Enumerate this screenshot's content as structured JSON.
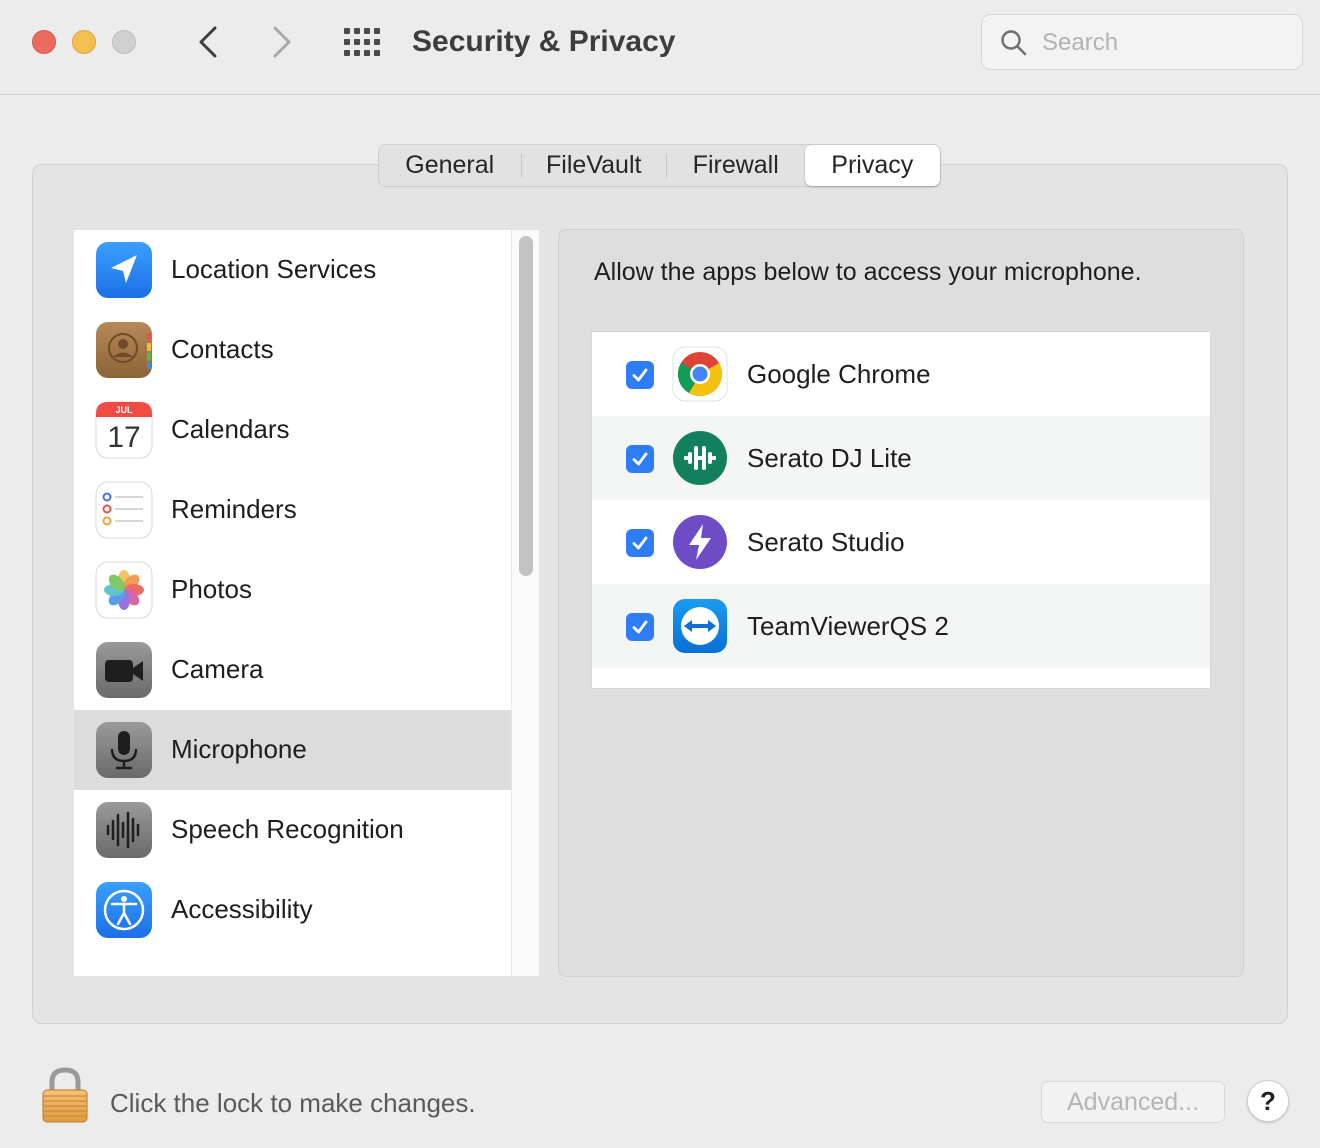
{
  "window": {
    "title": "Security & Privacy",
    "search_placeholder": "Search",
    "search_value": ""
  },
  "tabs": [
    {
      "label": "General",
      "selected": false
    },
    {
      "label": "FileVault",
      "selected": false
    },
    {
      "label": "Firewall",
      "selected": false
    },
    {
      "label": "Privacy",
      "selected": true
    }
  ],
  "sidebar": {
    "items": [
      {
        "label": "Location Services",
        "icon": "location-arrow-icon",
        "selected": false
      },
      {
        "label": "Contacts",
        "icon": "contacts-book-icon",
        "selected": false
      },
      {
        "label": "Calendars",
        "icon": "calendar-icon",
        "month": "JUL",
        "day": "17",
        "selected": false
      },
      {
        "label": "Reminders",
        "icon": "reminders-list-icon",
        "selected": false
      },
      {
        "label": "Photos",
        "icon": "photos-flower-icon",
        "selected": false
      },
      {
        "label": "Camera",
        "icon": "video-camera-icon",
        "selected": false
      },
      {
        "label": "Microphone",
        "icon": "microphone-icon",
        "selected": true
      },
      {
        "label": "Speech Recognition",
        "icon": "waveform-icon",
        "selected": false
      },
      {
        "label": "Accessibility",
        "icon": "accessibility-person-icon",
        "selected": false
      }
    ]
  },
  "content": {
    "description": "Allow the apps below to access your microphone.",
    "apps": [
      {
        "name": "Google Chrome",
        "icon": "chrome-icon",
        "checked": true
      },
      {
        "name": "Serato DJ Lite",
        "icon": "serato-dj-icon",
        "checked": true
      },
      {
        "name": "Serato Studio",
        "icon": "serato-studio-icon",
        "checked": true
      },
      {
        "name": "TeamViewerQS 2",
        "icon": "teamviewer-icon",
        "checked": true
      }
    ]
  },
  "footer": {
    "lock_text": "Click the lock to make changes.",
    "advanced_label": "Advanced...",
    "help_label": "?"
  },
  "colors": {
    "accent": "#2e7cf6",
    "close": "#ed6a5e",
    "minimize": "#f5bf4f",
    "zoom_disabled": "#d0d0d0"
  }
}
